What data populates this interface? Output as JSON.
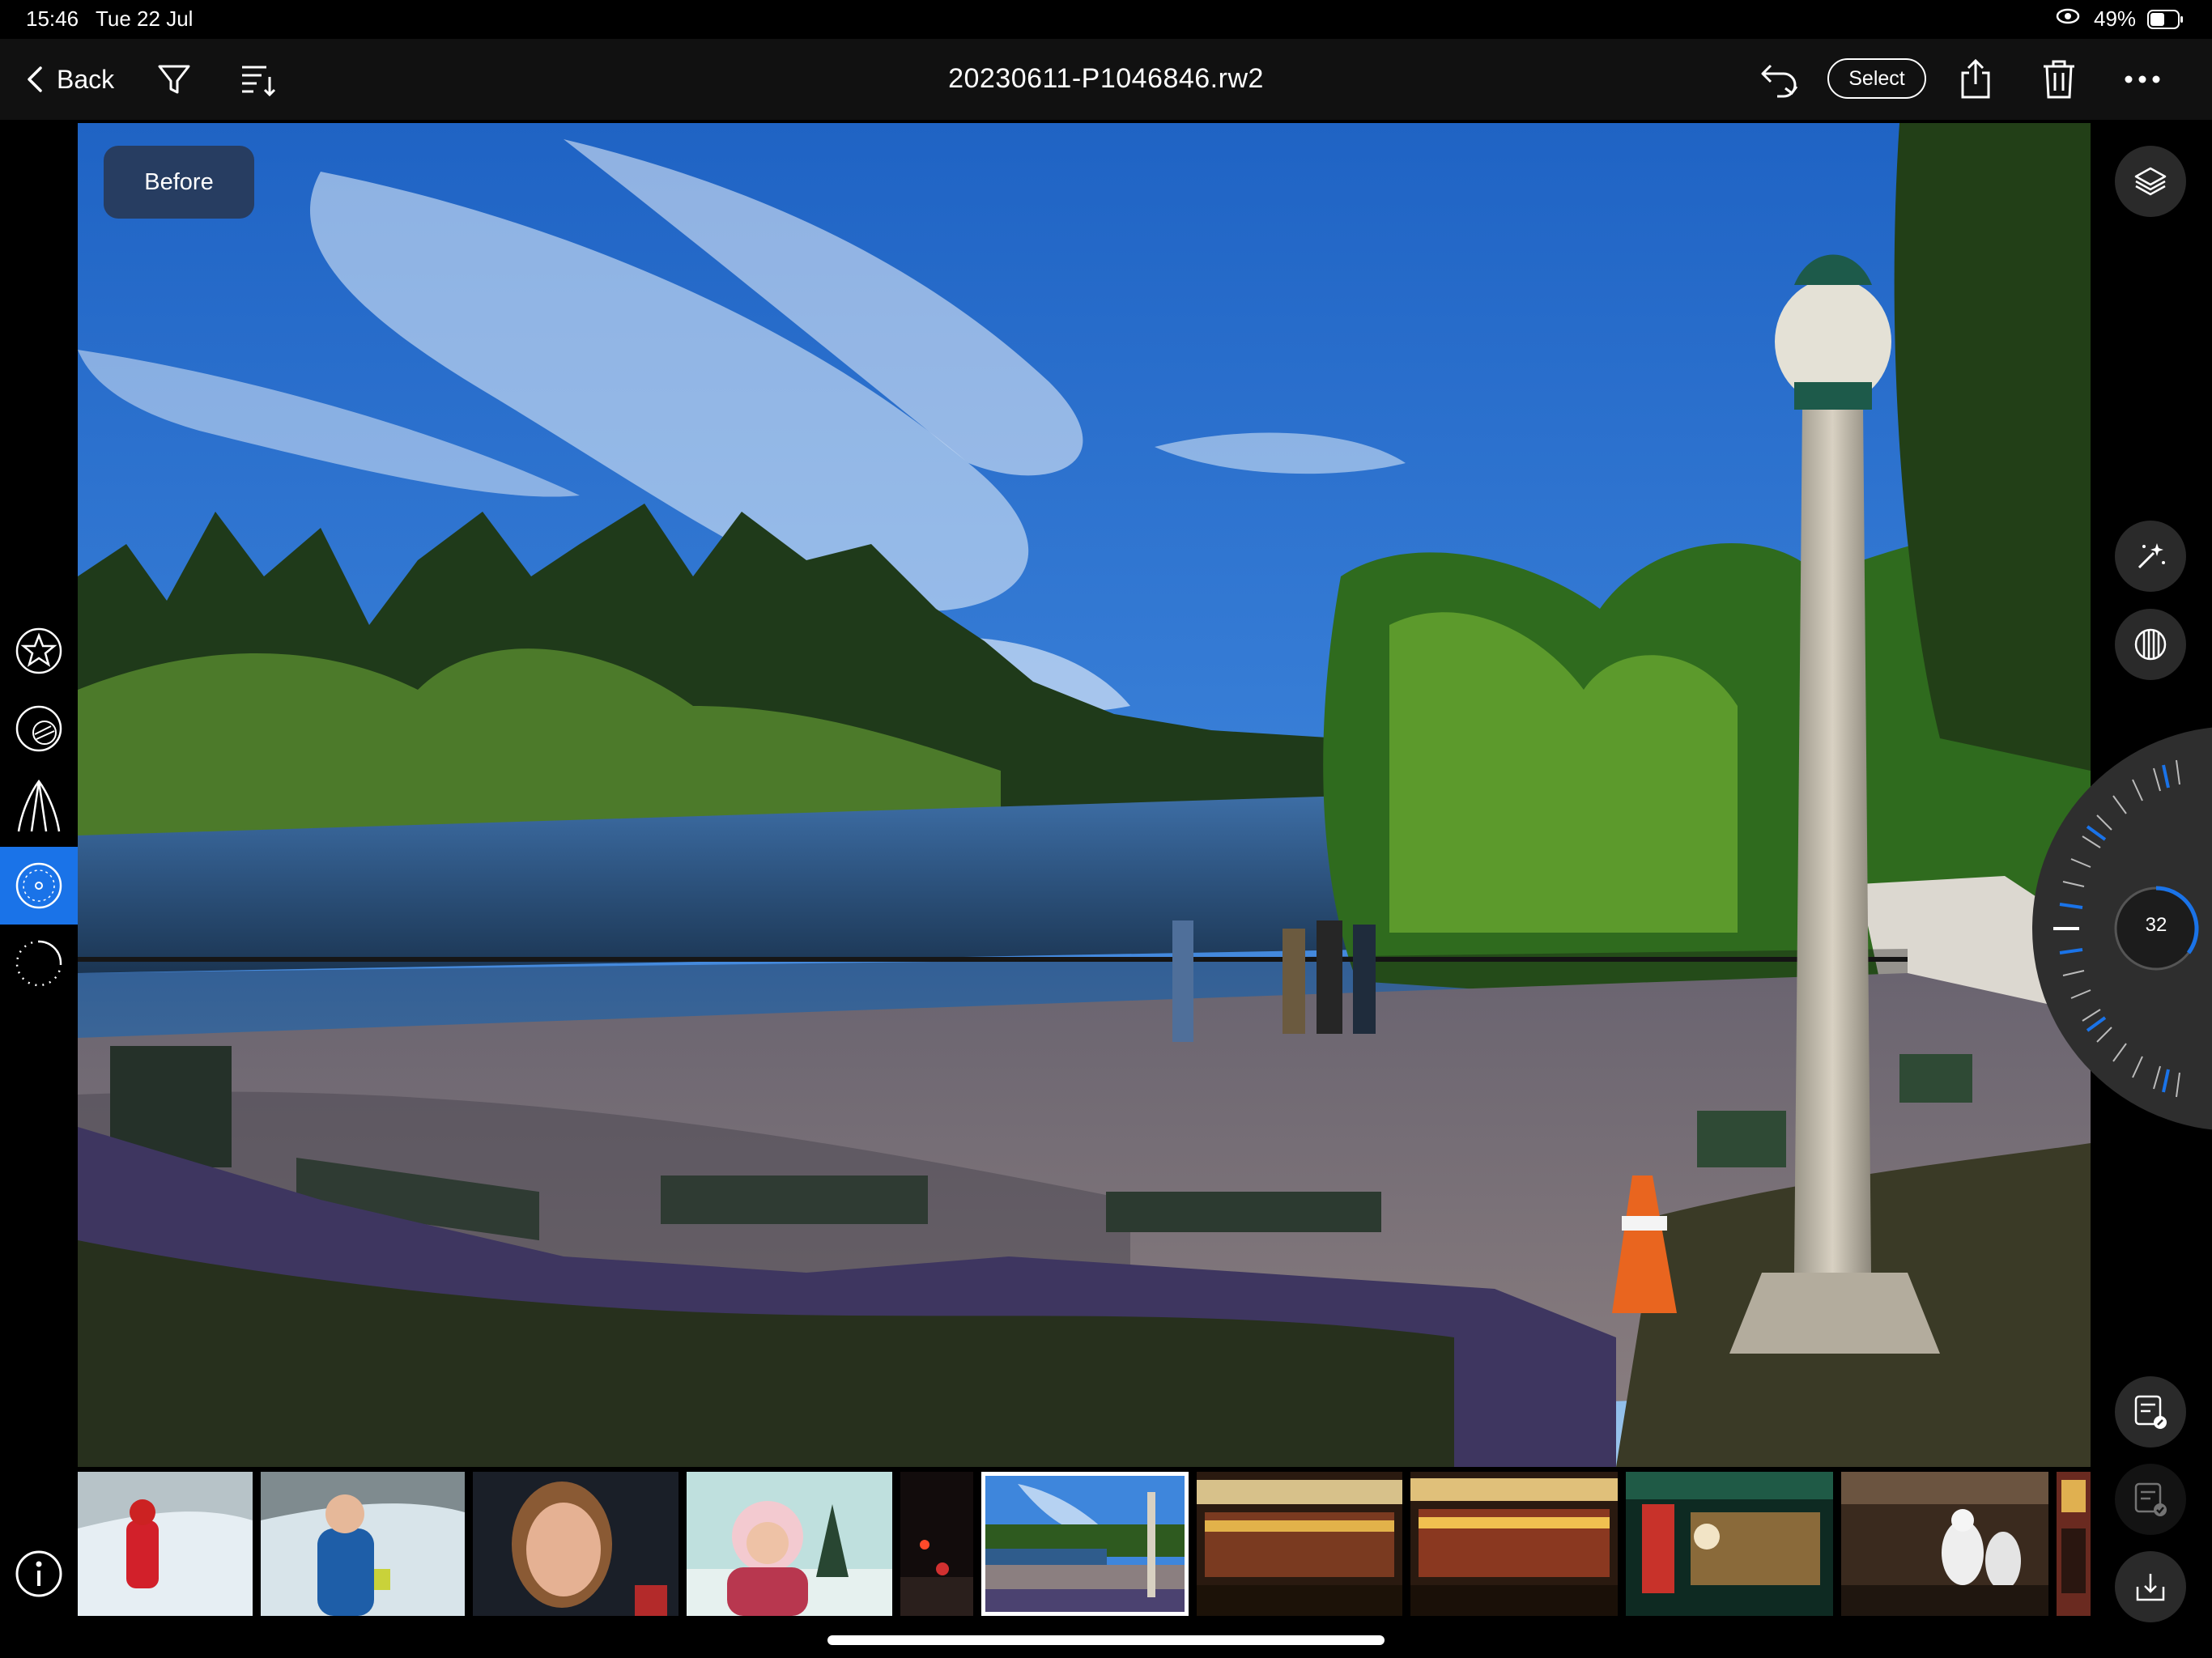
{
  "status": {
    "time": "15:46",
    "date": "Tue 22 Jul",
    "battery": "49%"
  },
  "topbar": {
    "back_label": "Back",
    "filename": "20230611-P1046846.rw2",
    "select_label": "Select"
  },
  "viewer": {
    "before_label": "Before"
  },
  "dial": {
    "value": "32"
  },
  "filmstrip": {
    "selected_index": 5,
    "count": 11
  },
  "colors": {
    "accent": "#1a73e8",
    "bar": "#111111",
    "before_chip": "#283a58"
  }
}
